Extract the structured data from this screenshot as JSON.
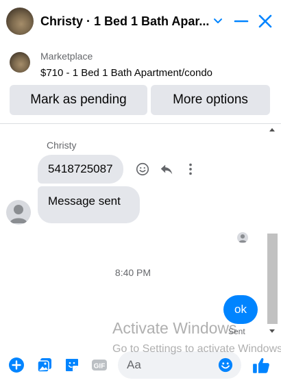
{
  "header": {
    "title": "Christy · 1 Bed 1 Bath Apar...",
    "icons": [
      "chevron-down-icon",
      "minimize-icon",
      "close-icon"
    ]
  },
  "marketplace": {
    "label": "Marketplace",
    "listing": "$710 - 1 Bed 1 Bath Apartment/condo",
    "mark_pending_label": "Mark as pending",
    "more_options_label": "More options"
  },
  "conversation": {
    "sender_name": "Christy",
    "messages": [
      {
        "text": "5418725087"
      },
      {
        "text": "Message sent"
      }
    ],
    "timestamp": "8:40 PM",
    "sent_message": "ok",
    "sent_status": "Sent"
  },
  "composer": {
    "placeholder": "Aa",
    "icons": [
      "plus-icon",
      "photo-icon",
      "sticker-icon",
      "gif-icon",
      "emoji-icon",
      "like-icon"
    ]
  },
  "watermark": {
    "line1": "Activate Windows",
    "line2": "Go to Settings to activate Windows."
  },
  "colors": {
    "accent": "#0084ff",
    "bubble_gray": "#e4e6eb",
    "secondary_text": "#65676b"
  }
}
